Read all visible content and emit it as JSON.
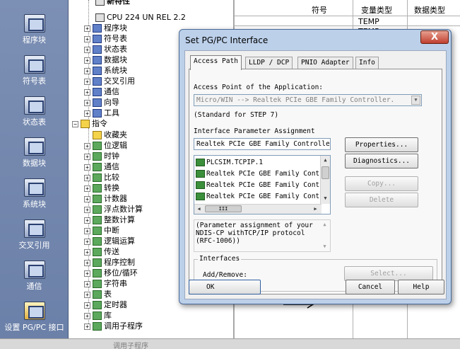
{
  "navbar": {
    "items": [
      {
        "label": "程序块"
      },
      {
        "label": "符号表"
      },
      {
        "label": "状态表"
      },
      {
        "label": "数据块"
      },
      {
        "label": "系统块"
      },
      {
        "label": "交叉引用"
      },
      {
        "label": "通信"
      },
      {
        "label": "设置 PG/PC 接口"
      }
    ]
  },
  "tree": {
    "top_item": "CPU 224 UN REL 2.2",
    "partial_top": "新特性",
    "project_items": [
      "程序块",
      "符号表",
      "状态表",
      "数据块",
      "系统块",
      "交叉引用",
      "通信",
      "向导",
      "工具"
    ],
    "instructions_label": "指令",
    "instruction_items": [
      "收藏夹",
      "位逻辑",
      "时钟",
      "通信",
      "比较",
      "转换",
      "计数器",
      "浮点数计算",
      "整数计算",
      "中断",
      "逻辑运算",
      "传送",
      "程序控制",
      "移位/循环",
      "字符串",
      "表",
      "定时器",
      "库",
      "调用子程序"
    ]
  },
  "table": {
    "headers": [
      "符号",
      "变量类型",
      "数据类型"
    ],
    "rows": [
      "TEMP",
      "TEMP"
    ]
  },
  "dialog": {
    "title": "Set PG/PC Interface",
    "close_glyph": "X",
    "tabs": [
      "Access Path",
      "LLDP / DCP",
      "PNIO Adapter",
      "Info"
    ],
    "access_point_label": "Access Point of the Application:",
    "access_point_value": "Micro/WIN      --> Realtek PCIe GBE Family Controller.",
    "standard_note": "(Standard for STEP 7)",
    "assignment_label": "Interface Parameter Assignment",
    "assignment_value": "Realtek PCIe GBE Family Controller",
    "interfaces": [
      "PLCSIM.TCPIP.1",
      "Realtek PCIe GBE Family Cont",
      "Realtek PCIe GBE Family Cont",
      "Realtek PCIe GBE Family Cont"
    ],
    "hscroll_grip": "III",
    "buttons": {
      "properties": "Properties...",
      "diagnostics": "Diagnostics...",
      "copy": "Copy...",
      "delete": "Delete",
      "select": "Select...",
      "ok": "OK",
      "cancel": "Cancel",
      "help": "Help"
    },
    "description": "(Parameter assignment of your NDIS-CP withTCP/IP protocol (RFC-1006))",
    "interfaces_group_label": "Interfaces",
    "add_remove_label": "Add/Remove:"
  },
  "statusbar": {
    "partial_text": "调用子程序"
  },
  "colors": {
    "navbar": "#6b80a8",
    "dialog_frame": "#bcd0ea",
    "close_button": "#c04030"
  }
}
